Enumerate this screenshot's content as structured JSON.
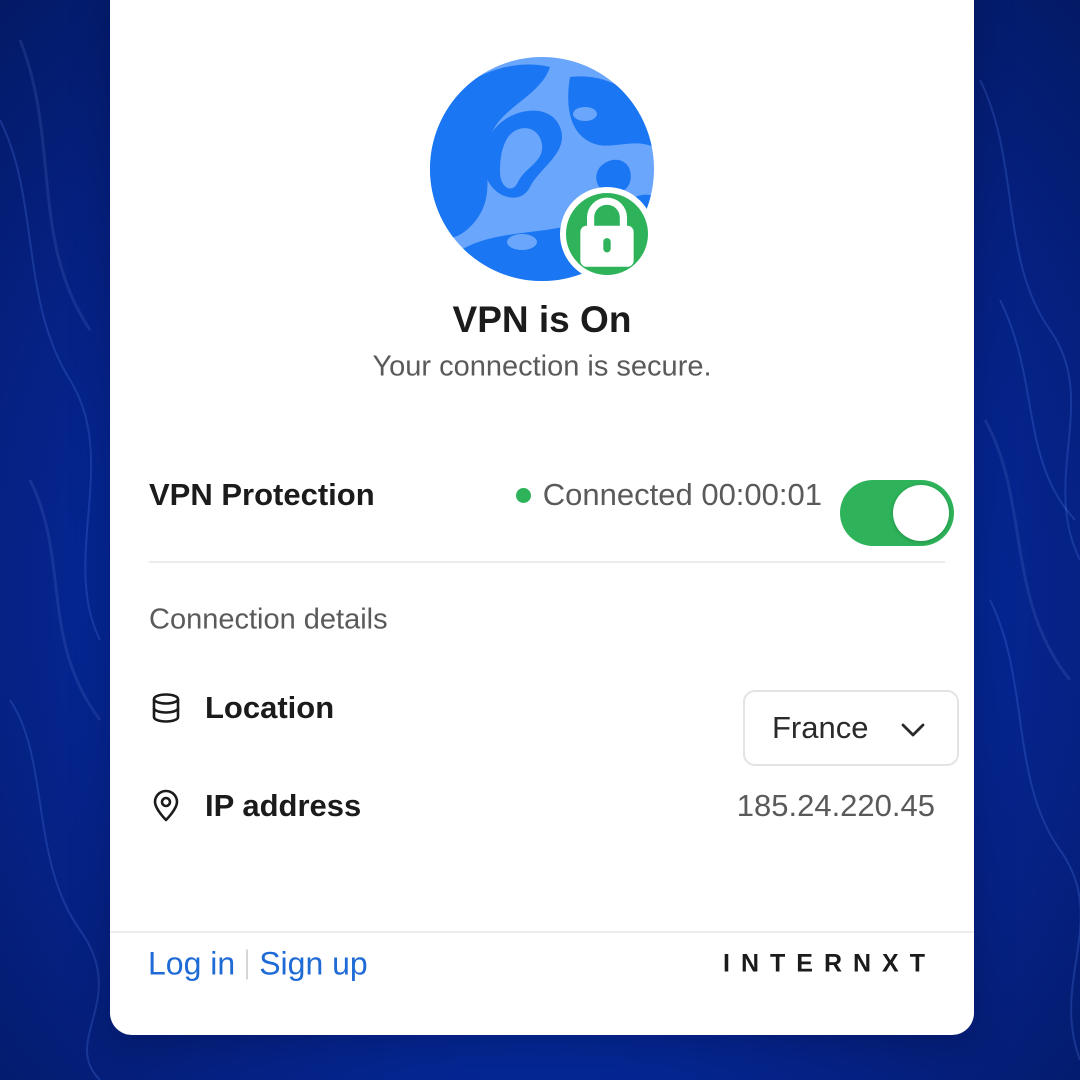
{
  "colors": {
    "accent_green": "#2eb35a",
    "link_blue": "#1f6bd6",
    "globe_blue": "#1a76f2",
    "globe_light": "#6aa6fb",
    "background_blue": "#0631b3"
  },
  "hero": {
    "icon": "globe-icon",
    "badge_icon": "lock-icon",
    "title": "VPN is On",
    "subtitle": "Your connection is secure."
  },
  "protection": {
    "label": "VPN Protection",
    "status": "Connected 00:00:01",
    "toggle_on": true
  },
  "details": {
    "title": "Connection details",
    "location": {
      "icon": "database-icon",
      "label": "Location",
      "value": "France",
      "dropdown_icon": "chevron-down-icon"
    },
    "ip": {
      "icon": "map-pin-icon",
      "label": "IP address",
      "value": "185.24.220.45"
    }
  },
  "footer": {
    "login": "Log in",
    "signup": "Sign up",
    "brand": "INTERNXT"
  }
}
